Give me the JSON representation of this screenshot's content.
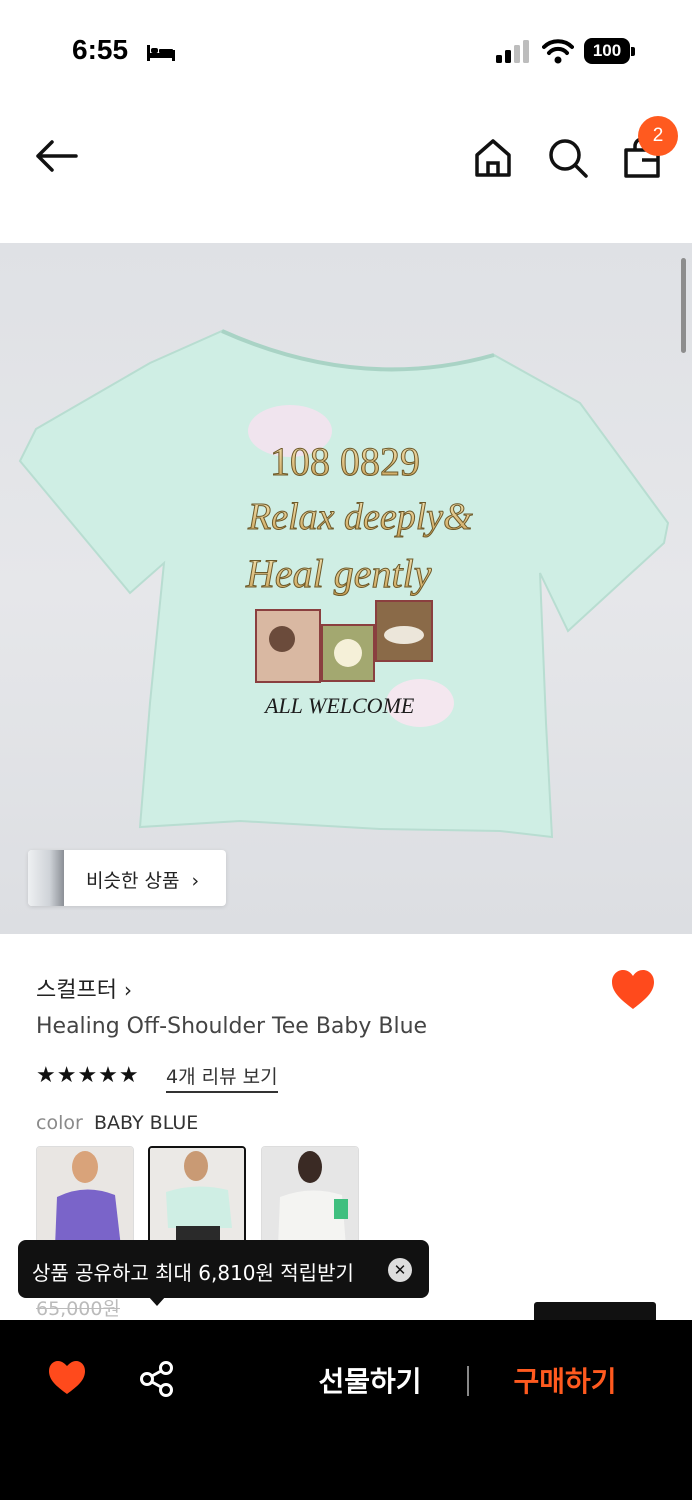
{
  "status_bar": {
    "time": "6:55",
    "battery": "100"
  },
  "nav": {
    "cart_count": "2"
  },
  "hero": {
    "print_lines": [
      "108 0829",
      "Relax deeply&",
      "Heal gently"
    ],
    "print_footer": "ALL WELCOME",
    "similar_label": "비슷한 상품"
  },
  "product": {
    "brand": "스컬프터",
    "title": "Healing Off-Shoulder Tee Baby Blue",
    "rating_stars": "★★★★★",
    "review_link": "4개 리뷰 보기",
    "option_label": "color",
    "option_value": "BABY BLUE",
    "price_original": "65,000원"
  },
  "toast": {
    "text": "상품 공유하고 최대 6,810원 적립받기",
    "close": "✕"
  },
  "bottom_bar": {
    "gift_label": "선물하기",
    "buy_label": "구매하기"
  },
  "colors": {
    "accent": "#ff5a1f",
    "bar": "#000000",
    "shirt": "#cfeee4"
  }
}
